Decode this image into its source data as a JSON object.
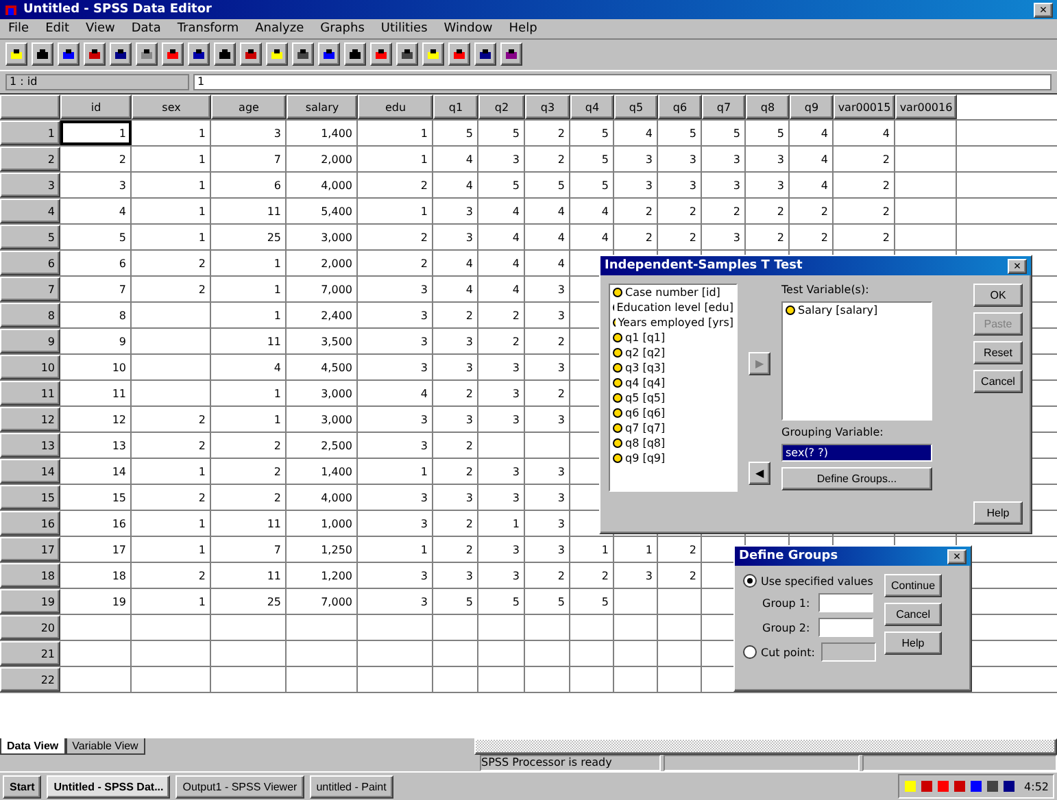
{
  "window": {
    "title": "Untitled - SPSS Data Editor",
    "close": "×"
  },
  "menu": [
    "File",
    "Edit",
    "View",
    "Data",
    "Transform",
    "Analyze",
    "Graphs",
    "Utilities",
    "Window",
    "Help"
  ],
  "cell_editor": {
    "address": "1 : id",
    "value": "1"
  },
  "table": {
    "columns": [
      "id",
      "sex",
      "age",
      "salary",
      "edu",
      "q1",
      "q2",
      "q3",
      "q4",
      "q5",
      "q6",
      "q7",
      "q8",
      "q9",
      "var00015",
      "var00016"
    ],
    "rows": [
      {
        "number": "1",
        "selected": true,
        "cells": [
          "1",
          "1",
          "3",
          "1,400",
          "1",
          "5",
          "5",
          "2",
          "5",
          "4",
          "5",
          "5",
          "5",
          "4",
          "4",
          null
        ]
      },
      {
        "number": "2",
        "selected": false,
        "cells": [
          "2",
          "1",
          "7",
          "2,000",
          "1",
          "4",
          "3",
          "2",
          "5",
          "3",
          "3",
          "3",
          "3",
          "4",
          "2",
          null
        ]
      },
      {
        "number": "3",
        "selected": false,
        "cells": [
          "3",
          "1",
          "6",
          "4,000",
          "2",
          "4",
          "5",
          "5",
          "5",
          "3",
          "3",
          "3",
          "3",
          "4",
          "2",
          null
        ]
      },
      {
        "number": "4",
        "selected": false,
        "cells": [
          "4",
          "1",
          "11",
          "5,400",
          "1",
          "3",
          "4",
          "4",
          "4",
          "2",
          "2",
          "2",
          "2",
          "2",
          "2",
          null
        ]
      },
      {
        "number": "5",
        "selected": false,
        "cells": [
          "5",
          "1",
          "25",
          "3,000",
          "2",
          "3",
          "4",
          "4",
          "4",
          "2",
          "2",
          "3",
          "2",
          "2",
          "2",
          null
        ]
      },
      {
        "number": "6",
        "selected": false,
        "cells": [
          "6",
          "2",
          "1",
          "2,000",
          "2",
          "4",
          "4",
          "4",
          null,
          null,
          null,
          null,
          null,
          null,
          null,
          null
        ]
      },
      {
        "number": "7",
        "selected": false,
        "cells": [
          "7",
          "2",
          "1",
          "7,000",
          "3",
          "4",
          "4",
          "3",
          null,
          null,
          null,
          null,
          null,
          null,
          null,
          null
        ]
      },
      {
        "number": "8",
        "selected": false,
        "cells": [
          "8",
          null,
          "1",
          "2,400",
          "3",
          "2",
          "2",
          "3",
          null,
          null,
          null,
          null,
          null,
          null,
          null,
          null
        ]
      },
      {
        "number": "9",
        "selected": false,
        "cells": [
          "9",
          null,
          "11",
          "3,500",
          "3",
          "3",
          "2",
          "2",
          null,
          null,
          null,
          null,
          null,
          null,
          null,
          null
        ]
      },
      {
        "number": "10",
        "selected": false,
        "cells": [
          "10",
          null,
          "4",
          "4,500",
          "3",
          "3",
          "3",
          "3",
          null,
          null,
          null,
          null,
          null,
          null,
          null,
          null
        ]
      },
      {
        "number": "11",
        "selected": false,
        "cells": [
          "11",
          null,
          "1",
          "3,000",
          "4",
          "2",
          "3",
          "2",
          null,
          null,
          null,
          null,
          null,
          null,
          null,
          null
        ]
      },
      {
        "number": "12",
        "selected": false,
        "cells": [
          "12",
          "2",
          "1",
          "3,000",
          "3",
          "3",
          "3",
          "3",
          null,
          null,
          null,
          null,
          null,
          null,
          null,
          null
        ]
      },
      {
        "number": "13",
        "selected": false,
        "cells": [
          "13",
          "2",
          "2",
          "2,500",
          "3",
          "2",
          null,
          null,
          null,
          null,
          null,
          null,
          null,
          null,
          null,
          null
        ]
      },
      {
        "number": "14",
        "selected": false,
        "cells": [
          "14",
          "1",
          "2",
          "1,400",
          "1",
          "2",
          "3",
          "3",
          null,
          null,
          null,
          null,
          null,
          null,
          null,
          null
        ]
      },
      {
        "number": "15",
        "selected": false,
        "cells": [
          "15",
          "2",
          "2",
          "4,000",
          "3",
          "3",
          "3",
          "3",
          null,
          null,
          null,
          null,
          null,
          null,
          null,
          null
        ]
      },
      {
        "number": "16",
        "selected": false,
        "cells": [
          "16",
          "1",
          "11",
          "1,000",
          "3",
          "2",
          "1",
          "3",
          null,
          null,
          null,
          null,
          null,
          null,
          null,
          null
        ]
      },
      {
        "number": "17",
        "selected": false,
        "cells": [
          "17",
          "1",
          "7",
          "1,250",
          "1",
          "2",
          "3",
          "3",
          "1",
          "1",
          "2",
          null,
          null,
          null,
          null,
          null
        ]
      },
      {
        "number": "18",
        "selected": false,
        "cells": [
          "18",
          "2",
          "11",
          "1,200",
          "3",
          "3",
          "3",
          "2",
          "2",
          "3",
          "2",
          null,
          null,
          null,
          null,
          null
        ]
      },
      {
        "number": "19",
        "selected": false,
        "cells": [
          "19",
          "1",
          "25",
          "7,000",
          "3",
          "5",
          "5",
          "5",
          "5",
          null,
          null,
          null,
          null,
          null,
          null,
          null
        ]
      },
      {
        "number": "20",
        "selected": false,
        "cells": []
      },
      {
        "number": "21",
        "selected": false,
        "cells": []
      },
      {
        "number": "22",
        "selected": false,
        "cells": []
      }
    ]
  },
  "sheet_tabs": [
    {
      "label": "Data View",
      "selected": true
    },
    {
      "label": "Variable View",
      "selected": false
    }
  ],
  "status_bar": "SPSS Processor is ready",
  "ttest_dialog": {
    "title": "Independent-Samples T Test",
    "close": "×",
    "variables": [
      "Case number [id]",
      "Education level [edu]",
      "Years employed [yrs]",
      "q1 [q1]",
      "q2 [q2]",
      "q3 [q3]",
      "q4 [q4]",
      "q5 [q5]",
      "q6 [q6]",
      "q7 [q7]",
      "q8 [q8]",
      "q9 [q9]"
    ],
    "test_label": "Test Variable(s):",
    "test_variables": [
      "Salary [salary]"
    ],
    "move_test": {
      "label": "▶",
      "disabled": true
    },
    "move_group": {
      "label": "◀",
      "disabled": false
    },
    "group_label": "Grouping Variable:",
    "group_value": "sex(? ?)",
    "define_groups": "Define Groups...",
    "buttons": [
      {
        "label": "OK",
        "disabled": false
      },
      {
        "label": "Paste",
        "disabled": true
      },
      {
        "label": "Reset",
        "disabled": false
      },
      {
        "label": "Cancel",
        "disabled": false
      },
      {
        "label": "Help",
        "disabled": false
      }
    ]
  },
  "groups_dialog": {
    "title": "Define Groups",
    "close": "×",
    "options": [
      {
        "label": "Use specified values",
        "selected": true
      },
      {
        "label": "Cut point:",
        "selected": false
      }
    ],
    "group1_label": "Group 1:",
    "group2_label": "Group 2:",
    "buttons": [
      "Continue",
      "Cancel",
      "Help"
    ]
  },
  "taskbar": {
    "start": "Start",
    "tasks": [
      {
        "label": "Untitled - SPSS Dat...",
        "selected": true
      },
      {
        "label": "Output1 - SPSS Viewer",
        "selected": false
      },
      {
        "label": "untitled - Paint",
        "selected": false
      }
    ],
    "clock": "4:52"
  }
}
